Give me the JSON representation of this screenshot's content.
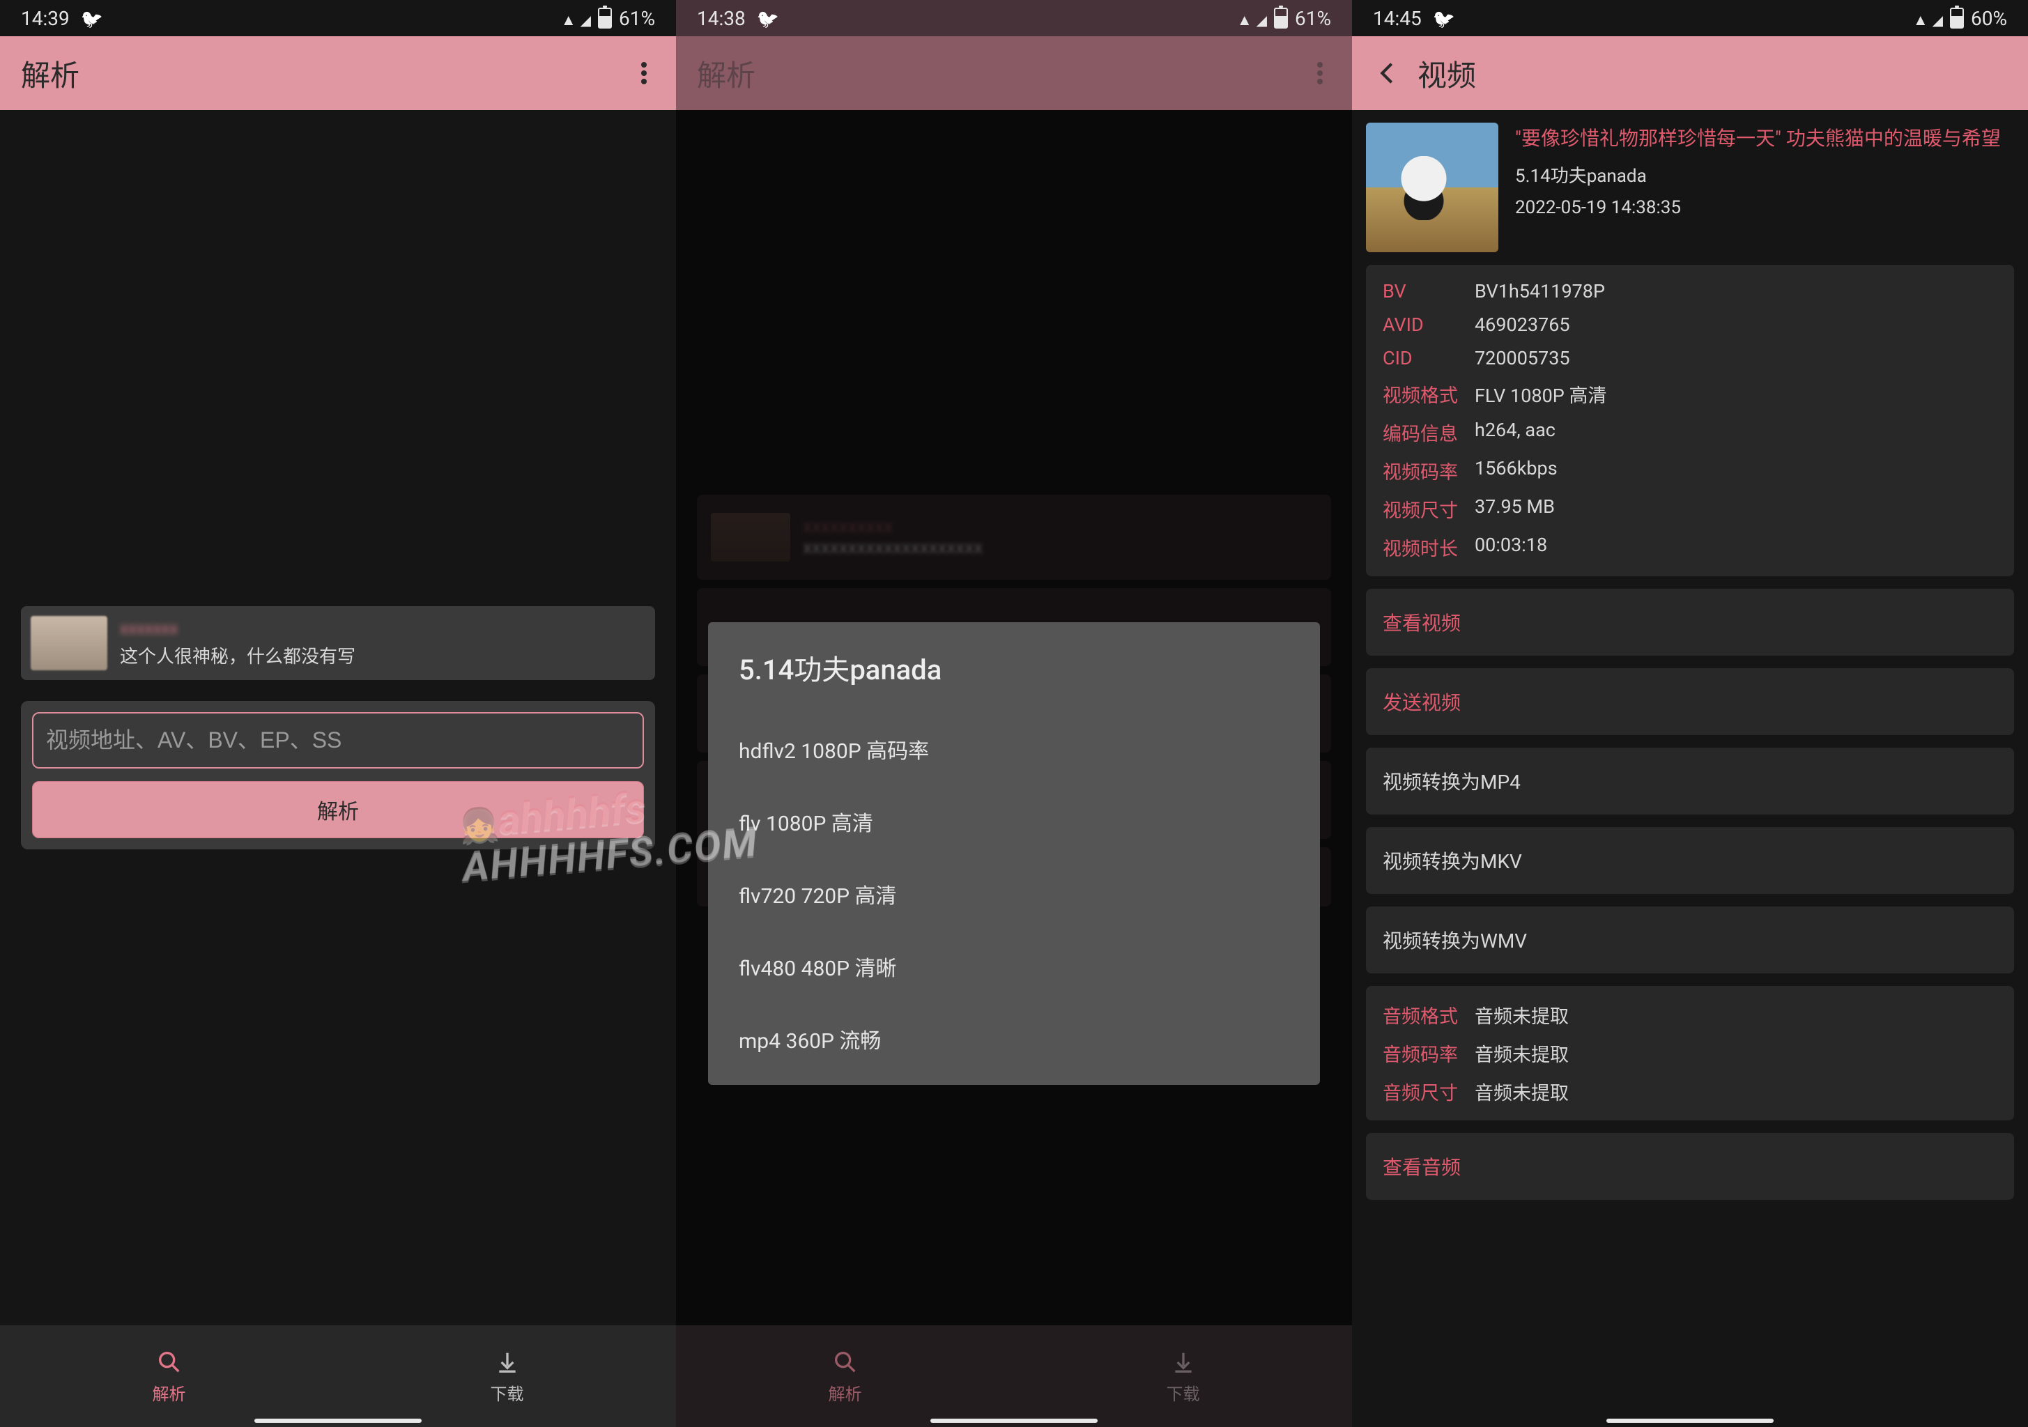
{
  "phone1": {
    "status": {
      "time": "14:39",
      "battery": "61%"
    },
    "appbar": {
      "title": "解析"
    },
    "profile": {
      "name": "xxxxxxx",
      "desc": "这个人很神秘，什么都没有写"
    },
    "input": {
      "placeholder": "视频地址、AV、BV、EP、SS"
    },
    "parse_button": "解析",
    "nav": {
      "parse": "解析",
      "download": "下载"
    }
  },
  "phone2": {
    "status": {
      "time": "14:38",
      "battery": "61%"
    },
    "appbar": {
      "title": "解析"
    },
    "dialog": {
      "title": "5.14功夫panada",
      "options": [
        "hdflv2 1080P 高码率",
        "flv 1080P 高清",
        "flv720 720P 高清",
        "flv480 480P 清晰",
        "mp4 360P 流畅"
      ]
    },
    "p1line": "P1:5.14功夫panada",
    "nav": {
      "parse": "解析",
      "download": "下载"
    }
  },
  "phone3": {
    "status": {
      "time": "14:45",
      "battery": "60%"
    },
    "appbar": {
      "title": "视频"
    },
    "video": {
      "title": "\"要像珍惜礼物那样珍惜每一天\" 功夫熊猫中的温暖与希望",
      "subtitle": "5.14功夫panada",
      "timestamp": "2022-05-19 14:38:35"
    },
    "info": [
      {
        "key": "BV",
        "val": "BV1h5411978P"
      },
      {
        "key": "AVID",
        "val": "469023765"
      },
      {
        "key": "CID",
        "val": "720005735"
      },
      {
        "key": "视频格式",
        "val": "FLV 1080P 高清"
      },
      {
        "key": "编码信息",
        "val": "h264, aac"
      },
      {
        "key": "视频码率",
        "val": "1566kbps"
      },
      {
        "key": "视频尺寸",
        "val": "37.95 MB"
      },
      {
        "key": "视频时长",
        "val": "00:03:18"
      }
    ],
    "actions": {
      "view": "查看视频",
      "send": "发送视频",
      "to_mp4": "视频转换为MP4",
      "to_mkv": "视频转换为MKV",
      "to_wmv": "视频转换为WMV"
    },
    "audio": [
      {
        "key": "音频格式",
        "val": "音频未提取"
      },
      {
        "key": "音频码率",
        "val": "音频未提取"
      },
      {
        "key": "音频尺寸",
        "val": "音频未提取"
      }
    ],
    "audio_action": "查看音频"
  },
  "watermark": {
    "line1": "ahhhhfs",
    "line2": "AHHHHFS.COM"
  }
}
